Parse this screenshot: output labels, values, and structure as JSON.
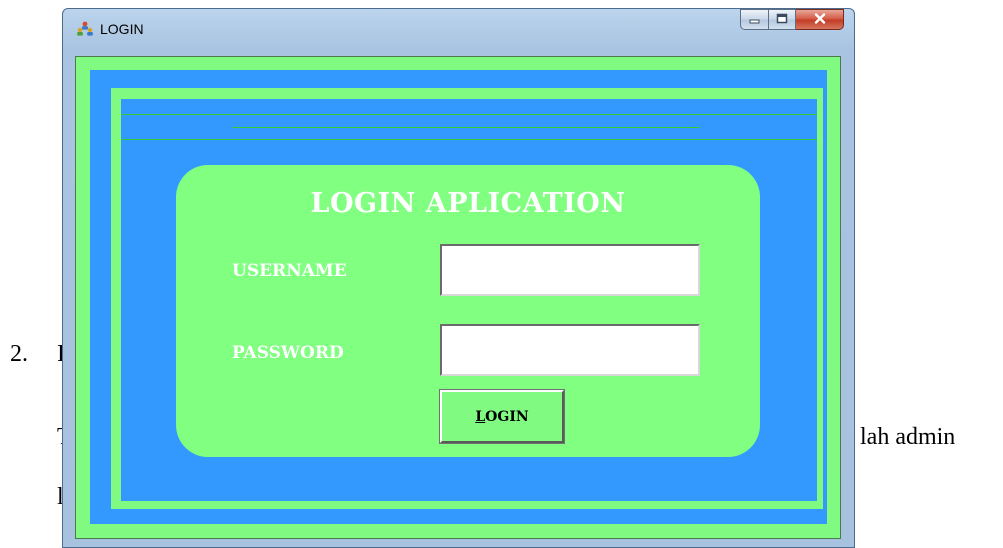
{
  "document": {
    "list_number": "2.",
    "list_letter_fragment": "I",
    "para_fragment_start": "T",
    "para_fragment_end": "lah admin",
    "para2_fragment_start": "l"
  },
  "window": {
    "title": "LOGIN",
    "controls": {
      "minimize": "–",
      "maximize": "□",
      "close": "x"
    }
  },
  "form": {
    "heading": "LOGIN APLICATION",
    "username_label": "USERNAME",
    "username_value": "",
    "password_label": "PASSWORD",
    "password_value": "",
    "button_mnemonic": "L",
    "button_rest": "OGIN"
  },
  "colors": {
    "form_green": "#80fa80",
    "panel_blue": "#3399ff",
    "line_green": "#33cc33"
  },
  "icons": {
    "app_icon": "network-people-icon"
  }
}
